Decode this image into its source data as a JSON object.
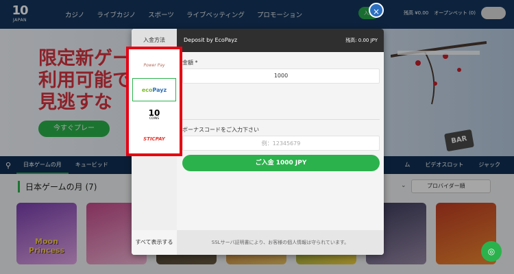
{
  "logo": {
    "mark": "10",
    "sub": "JAPAN"
  },
  "nav": {
    "items": [
      "カジノ",
      "ライブカジノ",
      "スポーツ",
      "ライブベッティング",
      "プロモーション"
    ]
  },
  "topbar": {
    "login": "入金",
    "balance": "残高 ¥0.00",
    "open_bets": "オープンベット (0)"
  },
  "banner": {
    "title_lines": [
      "限定新ゲー",
      "利用可能で",
      "見逃すな"
    ],
    "cta": "今すぐプレー",
    "sign": "BAR"
  },
  "catbar": {
    "items": [
      "日本ゲームの月",
      "キュービッド"
    ],
    "right_items": [
      "ム",
      "ビデオスロット",
      "ジャック"
    ]
  },
  "section": {
    "title": "日本ゲームの月 (7)",
    "provider": "プロバイダー順"
  },
  "games": [
    {
      "label": "Moon Princess"
    },
    {
      "label": ""
    },
    {
      "label": ""
    },
    {
      "label": ""
    },
    {
      "label": ""
    },
    {
      "label": ""
    },
    {
      "label": ""
    }
  ],
  "modal": {
    "side_title": "入金方法",
    "header_title": "Deposit by EcoPayz",
    "balance": "残高: 0.00 JPY",
    "amount_label": "金額 *",
    "amount_value": "1000",
    "bonus_label": "ボーナスコードをご入力下さい",
    "bonus_placeholder": "例：12345679",
    "deposit_button": "ご入金 1000 JPY",
    "show_all": "すべて表示する",
    "ssl_note": "SSLサーバ証明書により、お客様の個人情報は守られています。"
  },
  "methods": {
    "pp": "Power Pay",
    "eco_a": "eco",
    "eco_b": "Payz",
    "ten_big": "10",
    "ten_small": "COINS",
    "sticpay": "STICPAY"
  },
  "icons": {
    "close": "×",
    "chat": "◎",
    "search": "⚲"
  },
  "colors": {
    "accent_green": "#2bb24c",
    "highlight_red": "#e60012",
    "nav_blue": "#15365f"
  }
}
